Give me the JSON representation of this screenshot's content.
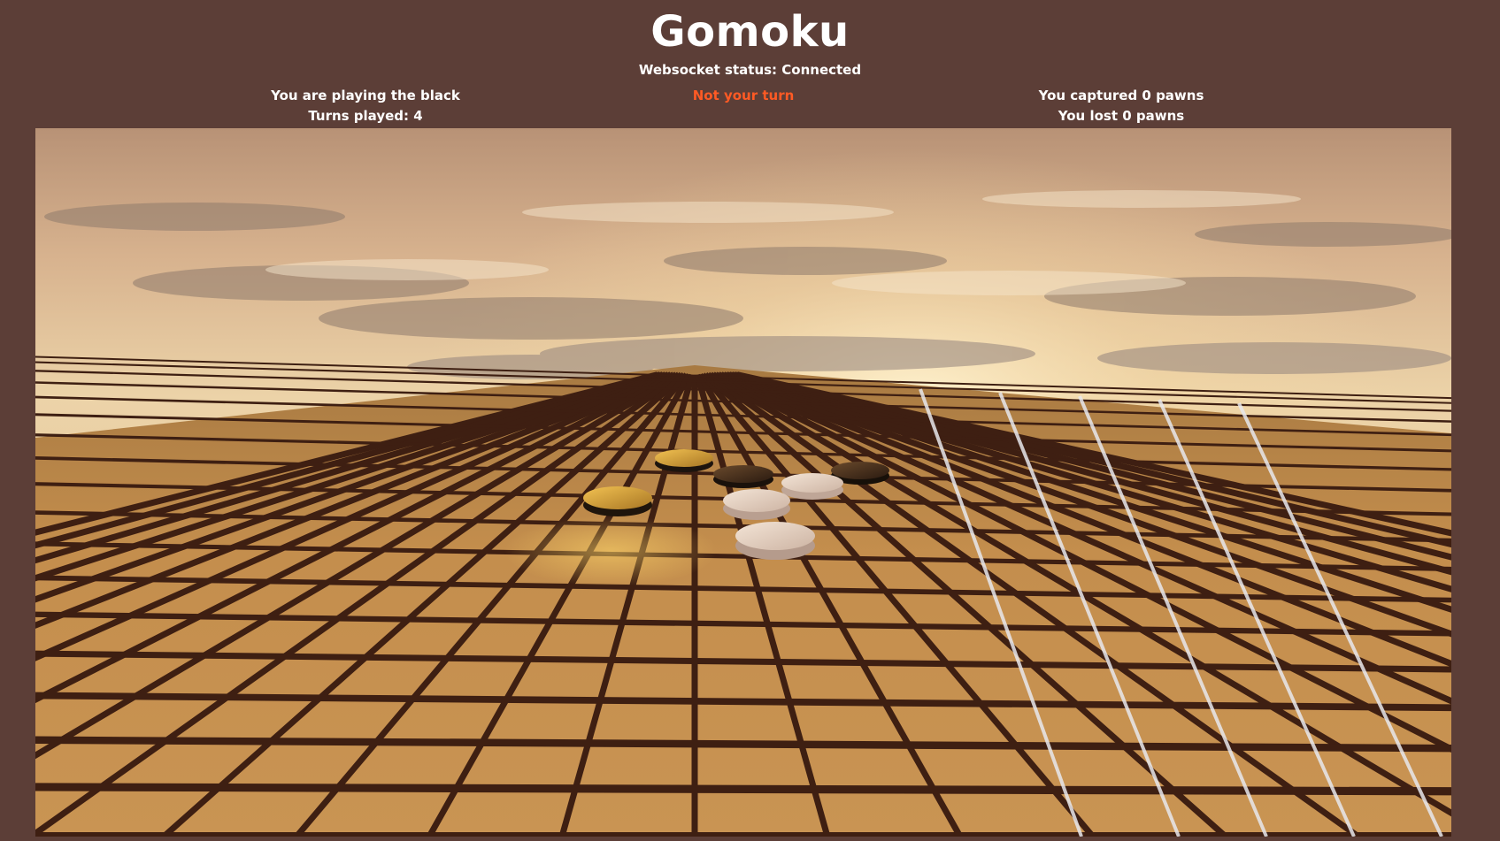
{
  "header": {
    "title": "Gomoku",
    "websocket_status": "Websocket status: Connected"
  },
  "player_info": {
    "color_label": "You are playing the black",
    "turns_played": "Turns played: 4"
  },
  "turn_status": {
    "label": "Not your turn",
    "color": "#ff5a24"
  },
  "score_info": {
    "captured": "You captured 0 pawns",
    "lost": "You lost 0 pawns"
  },
  "board": {
    "type": "3d-gomoku-board",
    "background": "sunset-sky-clouds",
    "pieces": [
      {
        "color": "black",
        "style": "gold-rim"
      },
      {
        "color": "black",
        "style": "dark"
      },
      {
        "color": "black",
        "style": "dark"
      },
      {
        "color": "black",
        "style": "gold-top"
      },
      {
        "color": "white",
        "style": "pale"
      },
      {
        "color": "white",
        "style": "pale"
      },
      {
        "color": "white",
        "style": "pale"
      }
    ]
  },
  "colors": {
    "page_background": "#5c3e37",
    "text": "#ffffff",
    "board_wood": "#c8924a",
    "groove": "#3a1c10"
  }
}
